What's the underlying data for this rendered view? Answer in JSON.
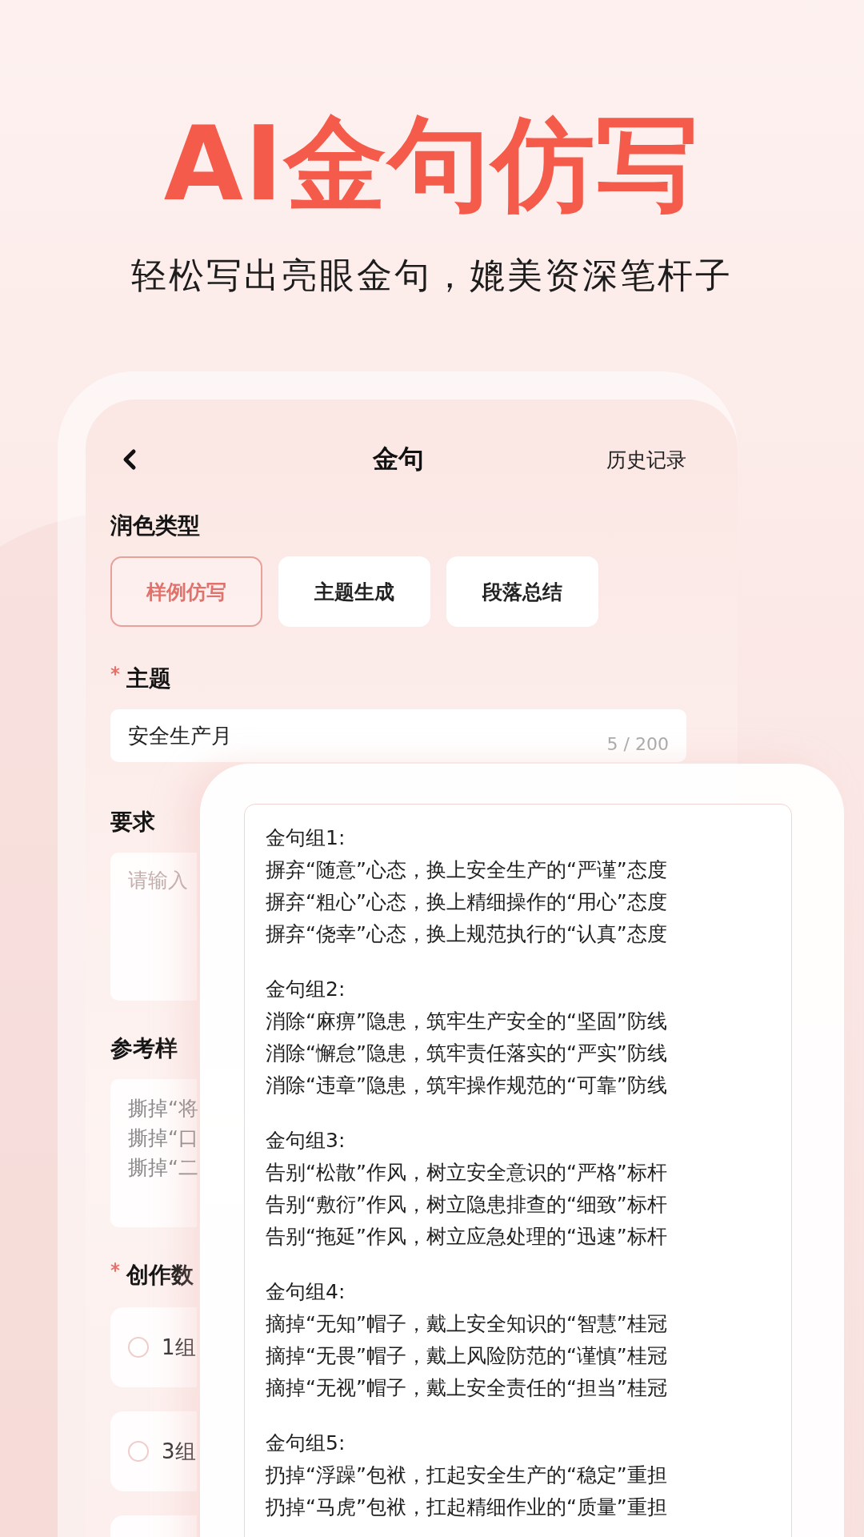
{
  "headline": {
    "title": "AI金句仿写",
    "subtitle": "轻松写出亮眼金句，媲美资深笔杆子"
  },
  "phone": {
    "nav": {
      "title": "金句",
      "action": "历史记录"
    },
    "polish_type": {
      "label": "润色类型",
      "options": [
        {
          "label": "样例仿写",
          "selected": true
        },
        {
          "label": "主题生成",
          "selected": false
        },
        {
          "label": "段落总结",
          "selected": false
        }
      ]
    },
    "topic": {
      "label": "主题",
      "required": true,
      "value": "安全生产月",
      "counter": "5 / 200"
    },
    "requirement": {
      "label": "要求",
      "required": false,
      "placeholder": "请输入"
    },
    "reference": {
      "label": "参考样",
      "required": false,
      "lines": [
        "撕掉“将",
        "撕掉“口",
        "撕掉“二"
      ]
    },
    "count": {
      "label": "创作数",
      "required": true,
      "options": [
        {
          "label": "1组",
          "selected": false
        },
        {
          "label": "3组",
          "selected": false
        }
      ]
    }
  },
  "result": {
    "groups": [
      {
        "title": "金句组1:",
        "lines": [
          "摒弃“随意”心态，换上安全生产的“严谨”态度",
          "摒弃“粗心”心态，换上精细操作的“用心”态度",
          "摒弃“侥幸”心态，换上规范执行的“认真”态度"
        ]
      },
      {
        "title": "金句组2:",
        "lines": [
          "消除“麻痹”隐患，筑牢生产安全的“坚固”防线",
          "消除“懈怠”隐患，筑牢责任落实的“严实”防线",
          "消除“违章”隐患，筑牢操作规范的“可靠”防线"
        ]
      },
      {
        "title": "金句组3:",
        "lines": [
          "告别“松散”作风，树立安全意识的“严格”标杆",
          "告别“敷衍”作风，树立隐患排查的“细致”标杆",
          "告别“拖延”作风，树立应急处理的“迅速”标杆"
        ]
      },
      {
        "title": "金句组4:",
        "lines": [
          "摘掉“无知”帽子，戴上安全知识的“智慧”桂冠",
          "摘掉“无畏”帽子，戴上风险防范的“谨慎”桂冠",
          "摘掉“无视”帽子，戴上安全责任的“担当”桂冠"
        ]
      },
      {
        "title": "金句组5:",
        "lines": [
          "扔掉“浮躁”包袱，扛起安全生产的“稳定”重担",
          "扔掉“马虎”包袱，扛起精细作业的“质量”重担"
        ]
      }
    ]
  }
}
